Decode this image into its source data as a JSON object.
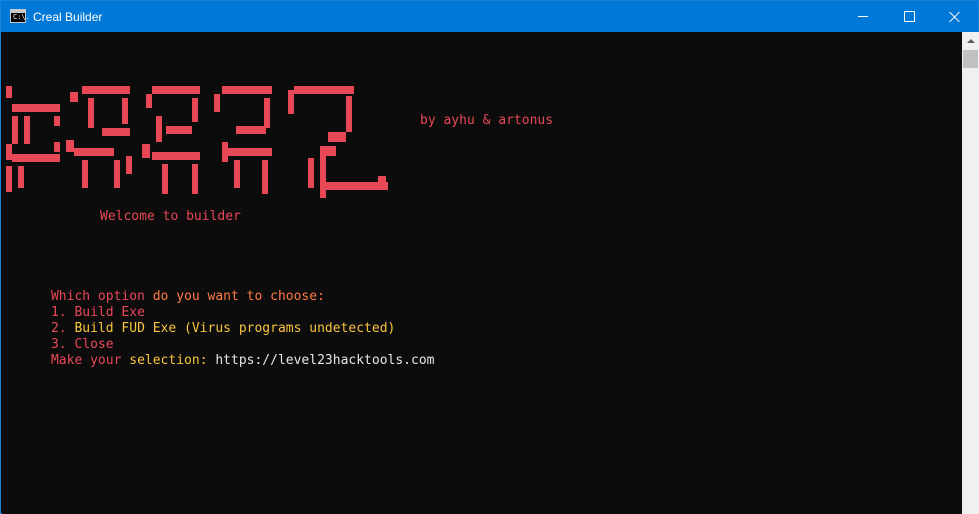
{
  "window": {
    "title": "Creal Builder",
    "icon": "console-icon",
    "icon_text": "C:\\."
  },
  "banner": {
    "logo_text": "CREAL",
    "credits": "by ayhu & artonus",
    "welcome": "Welcome to builder"
  },
  "menu": {
    "prompt_part1": "Which option ",
    "prompt_part2": "do you want to choose:",
    "option1_num": "1. ",
    "option1_text": "Build Exe",
    "option2_num": "2. ",
    "option2_text": "Build FUD Exe (Virus programs undetected)",
    "option3_num": "3. ",
    "option3_text": "Close",
    "selection_label_a": "Make your ",
    "selection_label_b": "selection: ",
    "selection_value": "https://level23hacktools.com"
  },
  "colors": {
    "background": "#0c0c0c",
    "titlebar": "#0078d7",
    "red": "#e74856",
    "yellow": "#f9c440",
    "orange": "#ff7a45"
  }
}
